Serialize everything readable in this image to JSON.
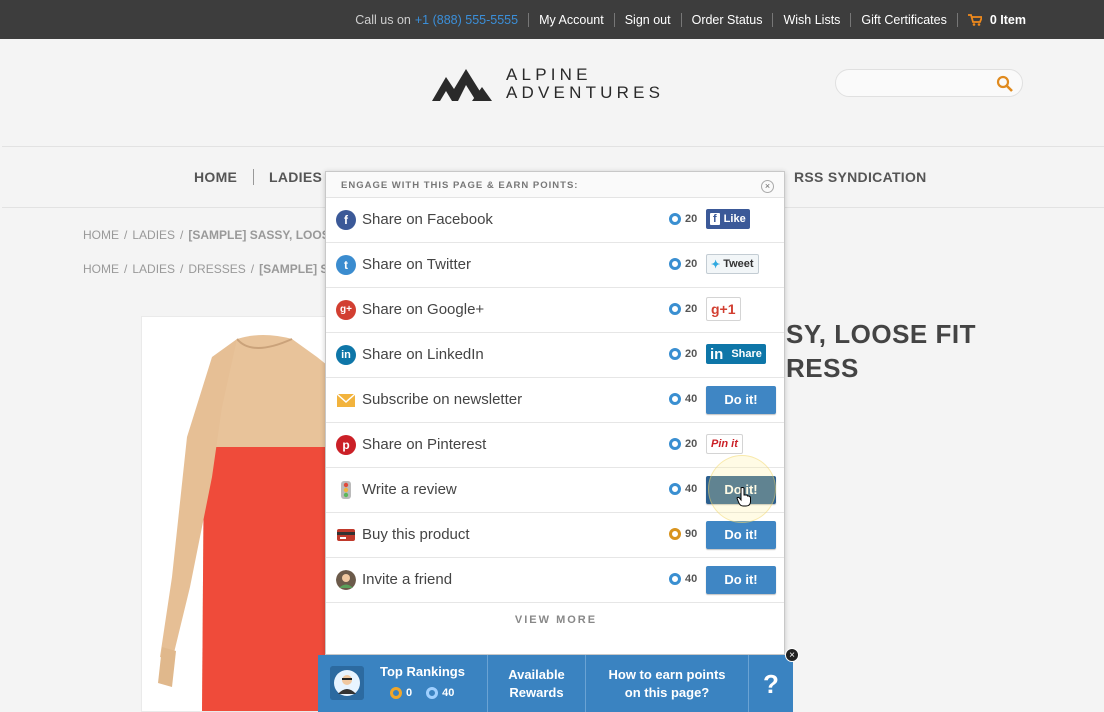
{
  "topbar": {
    "call_label": "Call us on",
    "phone": "+1 (888) 555-5555",
    "links": [
      "My Account",
      "Sign out",
      "Order Status",
      "Wish Lists",
      "Gift Certificates"
    ],
    "cart": "0 Item"
  },
  "logo": {
    "line1": "ALPINE",
    "line2": "ADVENTURES"
  },
  "search": {
    "placeholder": ""
  },
  "nav": {
    "home": "HOME",
    "ladies": "LADIES",
    "rss": "RSS SYNDICATION"
  },
  "breadcrumbs": [
    {
      "items": [
        "HOME",
        "LADIES"
      ],
      "current": "[SAMPLE] SASSY, LOOSE I"
    },
    {
      "items": [
        "HOME",
        "LADIES",
        "DRESSES"
      ],
      "current": "[SAMPLE] SASS"
    }
  ],
  "product": {
    "title_line1": "SY, LOOSE FIT",
    "title_line2": "RESS"
  },
  "popup": {
    "title": "ENGAGE WITH THIS PAGE & EARN POINTS:",
    "close": "×",
    "rows": [
      {
        "label": "Share on Facebook",
        "points": "20",
        "action": "Like"
      },
      {
        "label": "Share on Twitter",
        "points": "20",
        "action": "Tweet"
      },
      {
        "label": "Share on Google+",
        "points": "20",
        "action": "g+1"
      },
      {
        "label": "Share on LinkedIn",
        "points": "20",
        "action": "Share"
      },
      {
        "label": "Subscribe on newsletter",
        "points": "40",
        "action": "Do it!"
      },
      {
        "label": "Share on Pinterest",
        "points": "20",
        "action": "Pin it"
      },
      {
        "label": "Write a review",
        "points": "40",
        "action": "Do it!"
      },
      {
        "label": "Buy this product",
        "points": "90",
        "action": "Do it!"
      },
      {
        "label": "Invite a friend",
        "points": "40",
        "action": "Do it!"
      }
    ],
    "view_more": "VIEW MORE"
  },
  "bottombar": {
    "top_rankings": "Top Rankings",
    "gold_points": "0",
    "blue_points": "40",
    "rewards_line1": "Available",
    "rewards_line2": "Rewards",
    "earn_line1": "How to earn points",
    "earn_line2": "on this page?",
    "help": "?",
    "close": "×"
  },
  "colors": {
    "accent": "#3f86c4",
    "topbar": "#3d3d3d",
    "cart": "#f08a1c",
    "facebook": "#3b5998",
    "linkedin": "#0e76a8"
  }
}
